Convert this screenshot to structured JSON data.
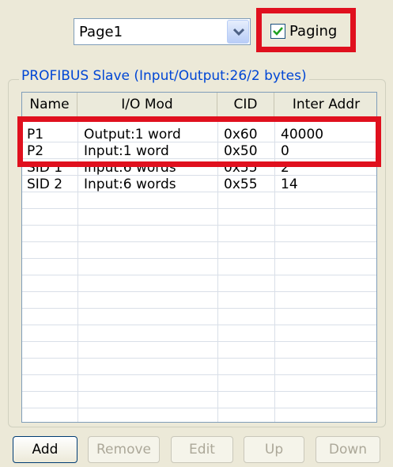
{
  "page_combo": {
    "value": "Page1"
  },
  "paging": {
    "label": "Paging",
    "checked": true
  },
  "group": {
    "title": "PROFIBUS Slave (Input/Output:26/2 bytes)"
  },
  "table": {
    "columns": [
      "Name",
      "I/O Mod",
      "CID",
      "Inter Addr"
    ],
    "rows": [
      {
        "name": "P1",
        "io_mod": "Output:1 word",
        "cid": "0x60",
        "inter_addr": "40000"
      },
      {
        "name": "P2",
        "io_mod": "Input:1 word",
        "cid": "0x50",
        "inter_addr": "0"
      },
      {
        "name": "SID 1",
        "io_mod": "Input:6 words",
        "cid": "0x55",
        "inter_addr": "2"
      },
      {
        "name": "SID 2",
        "io_mod": "Input:6 words",
        "cid": "0x55",
        "inter_addr": "14"
      }
    ]
  },
  "buttons": {
    "add": "Add",
    "remove": "Remove",
    "edit": "Edit",
    "up": "Up",
    "down": "Down"
  },
  "colors": {
    "highlight": "#e0101e",
    "group_title": "#0046d5"
  }
}
